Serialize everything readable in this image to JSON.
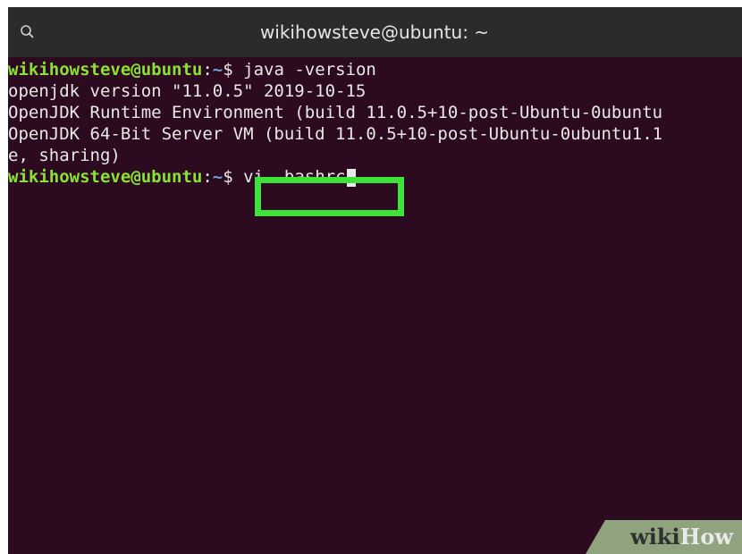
{
  "window": {
    "title": "wikihowsteve@ubuntu: ~",
    "search_icon": "search-icon",
    "colors": {
      "terminal_bg": "#2c0a1f",
      "titlebar_bg": "#2b2b2b",
      "prompt_user": "#8ae234",
      "prompt_path": "#729fcf",
      "highlight": "#3fe23a"
    }
  },
  "terminal": {
    "line1": {
      "user": "wikihowsteve@ubuntu",
      "sep": ":",
      "path": "~",
      "dollar": "$ ",
      "command": "java -version"
    },
    "line2": "openjdk version \"11.0.5\" 2019-10-15",
    "line3": "OpenJDK Runtime Environment (build 11.0.5+10-post-Ubuntu-0ubuntu",
    "line4": "OpenJDK 64-Bit Server VM (build 11.0.5+10-post-Ubuntu-0ubuntu1.1",
    "line5": "e, sharing)",
    "line6": {
      "user": "wikihowsteve@ubuntu",
      "sep": ":",
      "path": "~",
      "dollar": "$ ",
      "command": "vi .bashrc"
    }
  },
  "watermark": {
    "wiki": "wiki",
    "how": "How"
  }
}
